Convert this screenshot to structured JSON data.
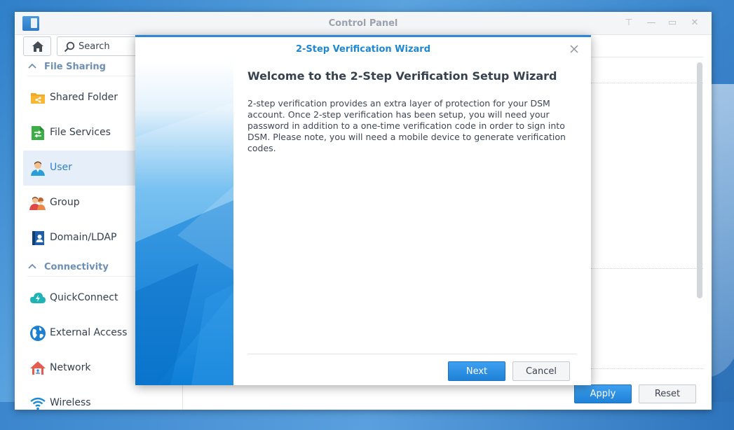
{
  "window": {
    "title": "Control Panel"
  },
  "toolbar": {
    "search_placeholder": "Search"
  },
  "sidebar": {
    "sections": [
      {
        "label": "File Sharing",
        "items": [
          {
            "label": "Shared Folder",
            "icon": "shared-folder-icon"
          },
          {
            "label": "File Services",
            "icon": "file-services-icon"
          },
          {
            "label": "User",
            "icon": "user-icon",
            "active": true
          },
          {
            "label": "Group",
            "icon": "group-icon"
          },
          {
            "label": "Domain/LDAP",
            "icon": "domain-ldap-icon"
          }
        ]
      },
      {
        "label": "Connectivity",
        "items": [
          {
            "label": "QuickConnect",
            "icon": "quickconnect-icon"
          },
          {
            "label": "External Access",
            "icon": "external-access-icon"
          },
          {
            "label": "Network",
            "icon": "network-icon"
          },
          {
            "label": "Wireless",
            "icon": "wireless-icon"
          }
        ]
      }
    ]
  },
  "footer": {
    "apply_label": "Apply",
    "reset_label": "Reset"
  },
  "wizard": {
    "title": "2-Step Verification Wizard",
    "heading": "Welcome to the 2-Step Verification Setup Wizard",
    "body": "2-step verification provides an extra layer of protection for your DSM account. Once 2-step verification has been setup, you will need your password in addition to a one-time verification code in order to sign into DSM. Please note, you will need a mobile device to generate verification codes.",
    "next_label": "Next",
    "cancel_label": "Cancel"
  },
  "colors": {
    "accent": "#2d87d6",
    "active_bg": "#e6eff9",
    "section_header": "#6d8fb4"
  }
}
